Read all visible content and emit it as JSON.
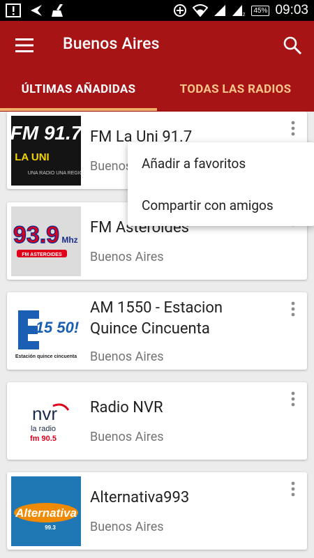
{
  "status_bar": {
    "time": "09:03",
    "battery": "45%",
    "signal_label": "2"
  },
  "app_bar": {
    "title": "Buenos Aires"
  },
  "tabs": [
    {
      "label": "ÚLTIMAS AÑADIDAS",
      "active": true
    },
    {
      "label": "TODAS LAS RADIOS",
      "active": false
    }
  ],
  "stations": [
    {
      "name": "FM La Uni 91.7",
      "city": "Buenos Aires",
      "logo": {
        "main": "FM 91.7",
        "sub": "LA UNI",
        "tag": "UNA RADIO UNA REGIÓN"
      }
    },
    {
      "name": "FM Asteroides",
      "city": "Buenos Aires",
      "logo": {
        "main": "93.9",
        "unit": "Mhz",
        "tag": "FM ASTEROIDES"
      }
    },
    {
      "name": "AM 1550 - Estacion Quince Cincuenta",
      "city": "Buenos Aires",
      "logo": {
        "main": "15 50!",
        "tag": "Estación quince cincuenta"
      }
    },
    {
      "name": "Radio NVR",
      "city": "Buenos Aires",
      "logo": {
        "main": "nvr",
        "sub": "la radio",
        "tag": "fm 90.5"
      }
    },
    {
      "name": "Alternativa993",
      "city": "Buenos Aires",
      "logo": {
        "main": "Alternativa",
        "tag": "99.3"
      }
    }
  ],
  "popup_menu": {
    "items": [
      "Añadir a favoritos",
      "Compartir con amigos"
    ]
  },
  "colors": {
    "primary": "#a71416",
    "accent": "#f0b26a",
    "tab_inactive": "#fbc68a"
  },
  "icons": [
    "notification-icon",
    "back-arrow-icon",
    "cleaner-icon",
    "data-saver-icon",
    "wifi-icon",
    "signal-icon",
    "signal-icon",
    "battery-icon",
    "menu-icon",
    "search-icon",
    "more-vert-icon"
  ]
}
